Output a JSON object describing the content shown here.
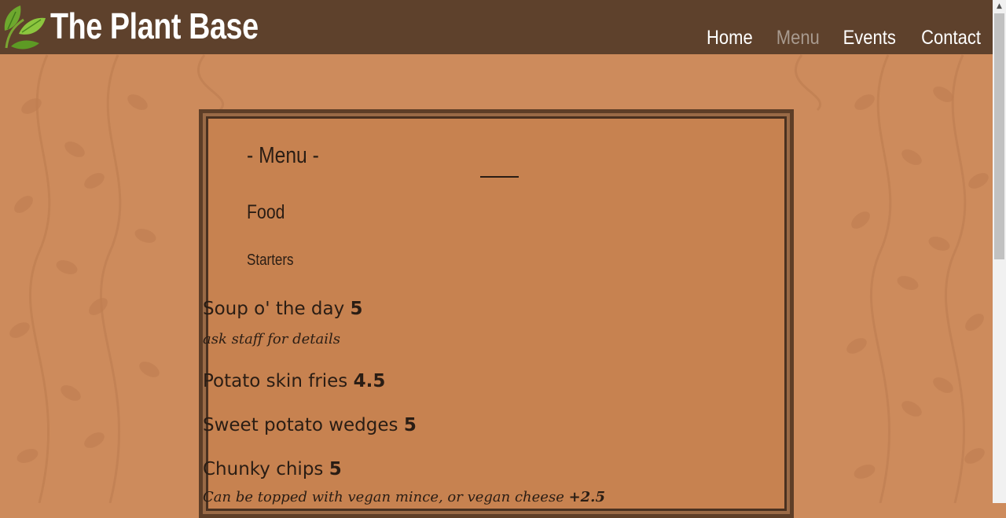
{
  "header": {
    "brand": "The Plant Base",
    "nav": [
      {
        "label": "Home",
        "active": false
      },
      {
        "label": "Menu",
        "active": true
      },
      {
        "label": "Events",
        "active": false
      },
      {
        "label": "Contact",
        "active": false
      }
    ]
  },
  "menu": {
    "title": "- Menu -",
    "section": "Food",
    "subsection": "Starters",
    "items": [
      {
        "name": "Soup o' the day",
        "price": "5",
        "note": "ask staff for details"
      },
      {
        "name": "Potato skin fries",
        "price": "4.5"
      },
      {
        "name": "Sweet potato wedges",
        "price": "5"
      },
      {
        "name": "Chunky chips",
        "price": "5",
        "note": "Can be topped with vegan mince, or vegan cheese",
        "note_price": "+2.5"
      }
    ]
  },
  "colors": {
    "navbar": "#5e412c",
    "background": "#cd8b5c",
    "menu_panel": "#c78250",
    "frame": "#5e3e27",
    "nav_active": "#a89a8f",
    "text": "#2a1d14"
  }
}
